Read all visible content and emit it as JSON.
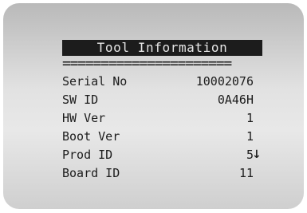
{
  "screen": {
    "title": "Tool Information",
    "separator": "======================"
  },
  "rows": [
    {
      "label": "Serial No",
      "value": "10002076"
    },
    {
      "label": "SW ID",
      "value": "0A46H"
    },
    {
      "label": "HW Ver",
      "value": "1"
    },
    {
      "label": "Boot Ver",
      "value": "1"
    },
    {
      "label": "Prod ID",
      "value": "5"
    },
    {
      "label": "Board ID",
      "value": "11"
    }
  ],
  "scroll_indicator": {
    "icon": "down-arrow-icon",
    "glyph": "↓"
  }
}
